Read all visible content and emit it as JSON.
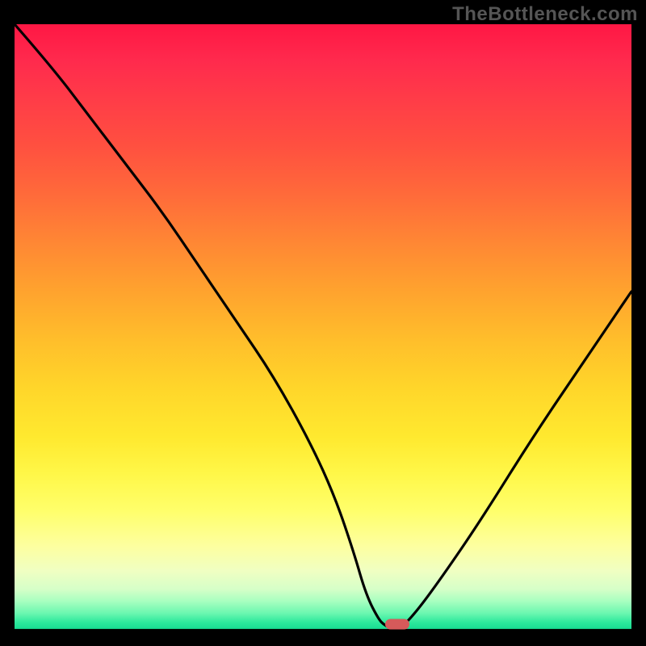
{
  "watermark": "TheBottleneck.com",
  "chart_data": {
    "type": "line",
    "title": "",
    "xlabel": "",
    "ylabel": "",
    "xlim": [
      0,
      100
    ],
    "ylim": [
      0,
      100
    ],
    "grid": false,
    "legend": false,
    "background_gradient": {
      "top": "#ff1744",
      "mid": "#ffe92f",
      "bottom": "#10d88f"
    },
    "series": [
      {
        "name": "bottleneck-curve",
        "color": "#000000",
        "x": [
          0,
          6,
          12,
          18,
          24,
          30,
          36,
          42,
          48,
          52,
          55,
          57,
          59,
          60,
          62,
          65,
          70,
          76,
          84,
          92,
          100
        ],
        "y": [
          100,
          93,
          85,
          77,
          69,
          60,
          51,
          42,
          31,
          22,
          13,
          6,
          2,
          1,
          0,
          3,
          10,
          19,
          32,
          44,
          56
        ]
      }
    ],
    "marker": {
      "name": "optimal-point",
      "color": "#d65a5a",
      "x": 62,
      "y": 1
    }
  }
}
